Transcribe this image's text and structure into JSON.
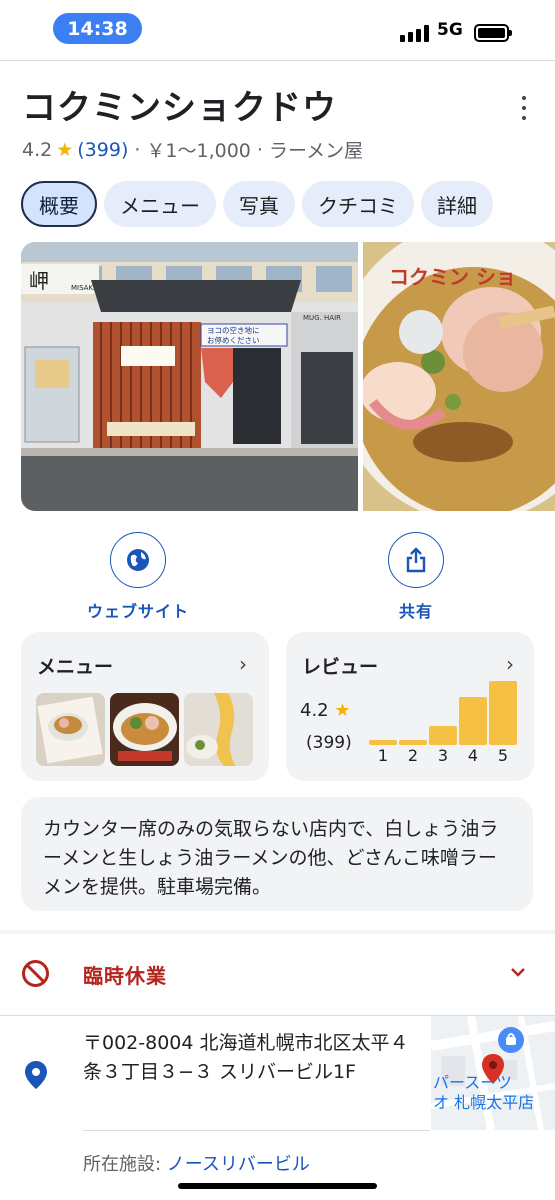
{
  "status_bar": {
    "time": "14:38",
    "network": "5G"
  },
  "place": {
    "name": "コクミンショクドウ",
    "rating": "4.2",
    "rating_star": "★",
    "review_count": "(399)",
    "sep1": "·",
    "price": "￥1〜1,000",
    "sep2": "·",
    "category": "ラーメン屋"
  },
  "tabs": [
    {
      "label": "概要"
    },
    {
      "label": "メニュー"
    },
    {
      "label": "写真"
    },
    {
      "label": "クチコミ"
    },
    {
      "label": "詳細"
    }
  ],
  "photos": {
    "sign_left": "岬",
    "sign_left_sub": "MISAKI",
    "sign_right": "MUG. HAIR",
    "parking_text_1": "ヨコの空き地に",
    "parking_text_2": "お停めください",
    "bowl_text": "コクミン ショ"
  },
  "actions": [
    {
      "label": "ウェブサイト",
      "icon": "globe-icon"
    },
    {
      "label": "共有",
      "icon": "share-icon"
    }
  ],
  "menu_card": {
    "title": "メニュー",
    "chevron": "›"
  },
  "review_card": {
    "title": "レビュー",
    "chevron": "›",
    "rating": "4.2",
    "star": "★",
    "count": "(399)",
    "distribution": [
      {
        "label": "1",
        "value": 0.08
      },
      {
        "label": "2",
        "value": 0.08
      },
      {
        "label": "3",
        "value": 0.3
      },
      {
        "label": "4",
        "value": 0.75
      },
      {
        "label": "5",
        "value": 1.0
      }
    ]
  },
  "description": "カウンター席のみの気取らない店内で、白しょう油ラーメンと生しょう油ラーメンの他、どさんこ味噌ラーメンを提供。駐車場完備。",
  "closed": {
    "label": "臨時休業",
    "color": "#b3261e"
  },
  "address": {
    "text": "〒002-8004 北海道札幌市北区太平４条３丁目３−３ スリバービル1F",
    "map_label_1": "パースーツ",
    "map_label_2": "オ 札幌太平店"
  },
  "facility": {
    "label": "所在施設: ",
    "link": "ノースリバービル"
  },
  "colors": {
    "accent": "#1a56b8",
    "star": "#f4b400",
    "bar": "#f6c142",
    "closed": "#b3261e"
  }
}
